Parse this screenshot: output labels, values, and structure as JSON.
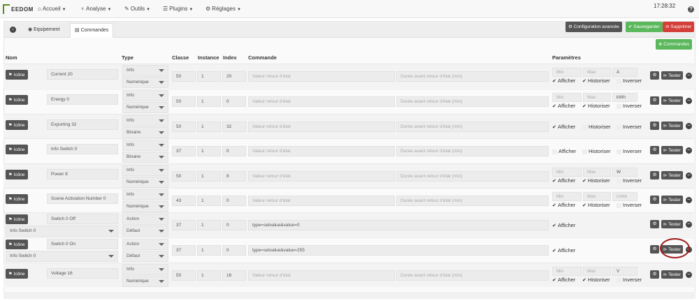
{
  "nav": {
    "brand": "EEDOM",
    "items": [
      {
        "label": "Accueil",
        "icon": "home-icon",
        "glyph": "⌂"
      },
      {
        "label": "Analyse",
        "icon": "pulse-icon",
        "glyph": "♆"
      },
      {
        "label": "Outils",
        "icon": "wrench-icon",
        "glyph": "✎"
      },
      {
        "label": "Plugins",
        "icon": "list-icon",
        "glyph": "☰"
      },
      {
        "label": "Réglages",
        "icon": "gear-icon",
        "glyph": "⚙"
      }
    ],
    "clock": "17:28:32",
    "help": "?"
  },
  "tabs": {
    "equipement": "Equipement",
    "commandes": "Commandes"
  },
  "actions": {
    "config": "Configuration avancée",
    "save": "Sauvegarder",
    "delete": "Supprimer",
    "add_command": "Commandes"
  },
  "headers": {
    "nom": "Nom",
    "type": "Type",
    "classe": "Classe",
    "instance": "Instance",
    "index": "Index",
    "commande": "Commande",
    "parametres": "Paramètres"
  },
  "labels": {
    "icon_button": "Icône",
    "tester": "Tester",
    "afficher": "Afficher",
    "historiser": "Historiser",
    "inverser": "Inverser",
    "min": "Min",
    "max": "Max",
    "unit_placeholder": "Unité",
    "value_placeholder": "Valeur retour d'état",
    "duration_placeholder": "Durée avant retour d'état (min)"
  },
  "rows": [
    {
      "name": "Current 20",
      "type": "Info",
      "subtype": "Numérique",
      "classe": "50",
      "instance": "1",
      "index": "20",
      "unit": "A",
      "kind": "info_num",
      "afficher": true,
      "historiser": true
    },
    {
      "name": "Energy 0",
      "type": "Info",
      "subtype": "Numérique",
      "classe": "50",
      "instance": "1",
      "index": "0",
      "unit": "kWh",
      "kind": "info_num",
      "afficher": true,
      "historiser": true
    },
    {
      "name": "Exporting 32",
      "type": "Info",
      "subtype": "Binaire",
      "classe": "50",
      "instance": "1",
      "index": "32",
      "unit": "",
      "kind": "info_bin",
      "afficher": true,
      "historiser": false
    },
    {
      "name": "Info Switch 0",
      "type": "Info",
      "subtype": "Binaire",
      "classe": "37",
      "instance": "1",
      "index": "0",
      "unit": "",
      "kind": "info_bin",
      "afficher": false,
      "historiser": false
    },
    {
      "name": "Power 8",
      "type": "Info",
      "subtype": "Numérique",
      "classe": "50",
      "instance": "1",
      "index": "8",
      "unit": "W",
      "kind": "info_num",
      "afficher": true,
      "historiser": true
    },
    {
      "name": "Scene Activation Number 0",
      "type": "Info",
      "subtype": "Numérique",
      "classe": "43",
      "instance": "1",
      "index": "0",
      "unit": "",
      "kind": "info_num",
      "afficher": true,
      "historiser": true
    },
    {
      "name": "Switch 0 Off",
      "linked": "Info Switch 0",
      "type": "Action",
      "subtype": "Défaut",
      "classe": "37",
      "instance": "1",
      "index": "0",
      "command": "type=setvalue&value=0",
      "kind": "action",
      "afficher": true
    },
    {
      "name": "Switch 0 On",
      "linked": "Info Switch 0",
      "type": "Action",
      "subtype": "Défaut",
      "classe": "37",
      "instance": "1",
      "index": "0",
      "command": "type=setvalue&value=255",
      "kind": "action",
      "afficher": true
    },
    {
      "name": "Voltage 16",
      "type": "Info",
      "subtype": "Numérique",
      "classe": "50",
      "instance": "1",
      "index": "16",
      "unit": "V",
      "kind": "info_num",
      "afficher": true,
      "historiser": true
    }
  ]
}
